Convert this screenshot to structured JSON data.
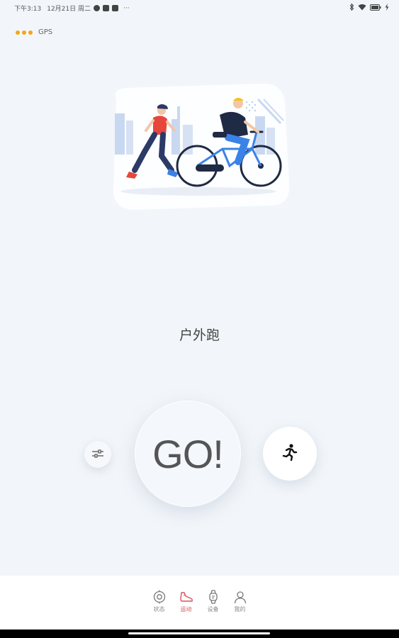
{
  "status_bar": {
    "time": "下午3:13",
    "date": "12月21日 周二",
    "dots": "···"
  },
  "gps": {
    "label": "GPS"
  },
  "workout": {
    "name": "户外跑",
    "go_label": "GO!"
  },
  "tabs": [
    {
      "label": "状态",
      "icon": "status-icon",
      "active": false
    },
    {
      "label": "运动",
      "icon": "shoe-icon",
      "active": true
    },
    {
      "label": "设备",
      "icon": "watch-icon",
      "active": false
    },
    {
      "label": "我的",
      "icon": "profile-icon",
      "active": false
    }
  ],
  "colors": {
    "background": "#f2f6fa",
    "accent_active": "#d9535b",
    "gps_dot": "#f3a51b",
    "bike_blue": "#3b82e8",
    "runner_red": "#e8453c"
  }
}
